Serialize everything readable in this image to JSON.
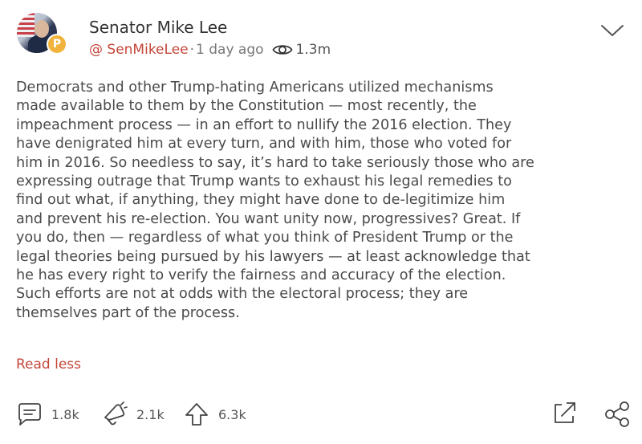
{
  "post": {
    "author_name": "Senator Mike Lee",
    "handle": "@ SenMikeLee",
    "separator": "·",
    "time_ago": "1 day ago",
    "views": "1.3m",
    "badge_letter": "P",
    "body_lines": [
      "Democrats and other Trump-hating Americans utilized mechanisms",
      "made available to them by the Constitution — most recently, the",
      "impeachment process — in an effort to nullify the 2016 election. They",
      "have denigrated him at every turn, and with him, those who voted for",
      "him in 2016. So needless to say, it’s hard to take seriously those who are",
      "expressing outrage that Trump wants to exhaust his legal remedies to",
      "find out what, if anything, they might have done to de-legitimize him",
      "and prevent his re-election. You want unity now, progressives? Great. If",
      "you do, then — regardless of what you think of President Trump or the",
      "legal theories being pursued by his lawyers — at least acknowledge that",
      "he has every right to verify the fairness and accuracy of the election.",
      "Such efforts are not at odds with the electoral process; they are",
      "themselves part of the process."
    ],
    "read_less_label": "Read less"
  },
  "actions": {
    "comments_count": "1.8k",
    "echoes_count": "2.1k",
    "upvotes_count": "6.3k"
  },
  "icons": {
    "menu": "chevron-down-icon",
    "views": "eye-icon",
    "comment": "comment-icon",
    "echo": "echo-megaphone-icon",
    "upvote": "upvote-arrow-icon",
    "expand": "expand-icon",
    "share": "share-icon"
  },
  "colors": {
    "accent": "#c4473a",
    "badge": "#f1b33b",
    "text": "#4a4a4a",
    "muted": "#777777"
  }
}
